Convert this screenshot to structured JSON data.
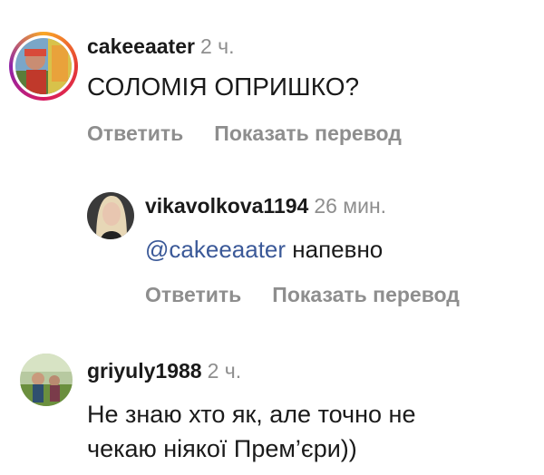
{
  "comments": [
    {
      "username": "cakeeaater",
      "time": "2 ч.",
      "text": "СОЛОМІЯ ОПРИШКО?",
      "reply_label": "Ответить",
      "translate_label": "Показать перевод"
    },
    {
      "username": "vikavolkova1194",
      "time": "26 мин.",
      "mention": "@cakeeaater",
      "text": "напевно",
      "reply_label": "Ответить",
      "translate_label": "Показать перевод"
    },
    {
      "username": "griyuly1988",
      "time": "2 ч.",
      "text_line1": "Не знаю хто як, але точно не",
      "text_line2": "чекаю ніякої Прем’єри))"
    }
  ]
}
